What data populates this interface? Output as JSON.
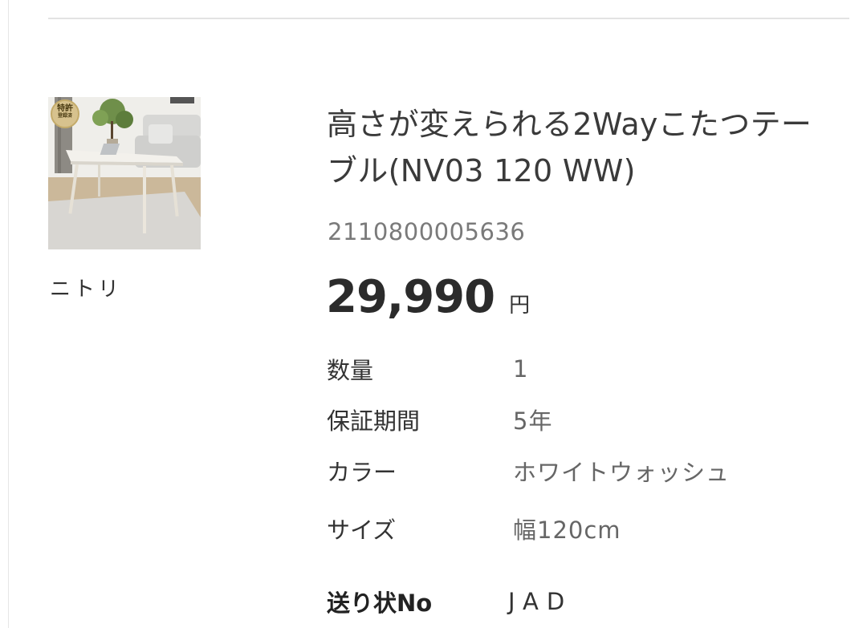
{
  "product": {
    "badge_line1": "特許",
    "badge_line2": "登録済",
    "maker": "ニトリ",
    "title": "高さが変えられる2Wayこたつテーブル(NV03 120 WW)",
    "sku": "2110800005636",
    "price": "29,990",
    "currency": "円"
  },
  "specs": [
    {
      "label": "数量",
      "value": "1"
    },
    {
      "label": "保証期間",
      "value": "5年"
    },
    {
      "label": "カラー",
      "value": "ホワイトウォッシュ"
    },
    {
      "label": "サイズ",
      "value": "幅120cm"
    }
  ],
  "shipping": {
    "label": "送り状No",
    "carrier": "JAD",
    "tracking_color": "#5aa7d8"
  }
}
